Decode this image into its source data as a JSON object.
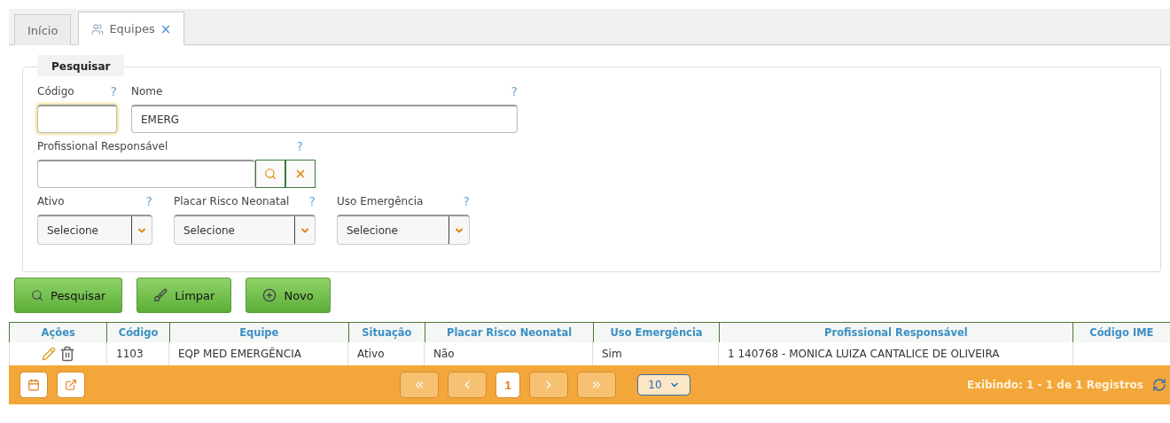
{
  "tabs": [
    {
      "label": "Início",
      "selected": false
    },
    {
      "label": "Equipes",
      "selected": true,
      "close": "×"
    }
  ],
  "search": {
    "legend": "Pesquisar",
    "fields": [
      {
        "label": "Código",
        "help": "?",
        "focused": true
      },
      {
        "label": "Nome",
        "help": "?",
        "value": "EMERG",
        "focused": false
      }
    ],
    "professional": {
      "label": "Profissional Responsável",
      "help": "?"
    },
    "selects": [
      {
        "label": "Ativo",
        "help": "?",
        "value": "Selecione"
      },
      {
        "label": "Placar Risco Neonatal",
        "help": "?",
        "value": "Selecione"
      },
      {
        "label": "Uso Emergência",
        "help": "?",
        "value": "Selecione"
      }
    ]
  },
  "buttons": [
    {
      "kind": "search",
      "label": "Pesquisar"
    },
    {
      "kind": "clear",
      "label": "Limpar"
    },
    {
      "kind": "new",
      "label": "Novo"
    }
  ],
  "table": {
    "columns": [
      "Ações",
      "Código",
      "Equipe",
      "Situação",
      "Placar Risco Neonatal",
      "Uso Emergência",
      "Profissional Responsável",
      "Código IME"
    ],
    "rows": [
      {
        "cells": [
          "",
          "1103",
          "EQP MED EMERGÊNCIA",
          "Ativo",
          "Não",
          "Sim",
          "1 140768 - MONICA LUIZA CANTALICE DE OLIVEIRA",
          ""
        ]
      }
    ]
  },
  "pager": {
    "pages": [
      {
        "label": "1",
        "selected": true
      }
    ],
    "page_size": "10",
    "summary": "Exibindo: 1 - 1 de 1 Registros"
  }
}
